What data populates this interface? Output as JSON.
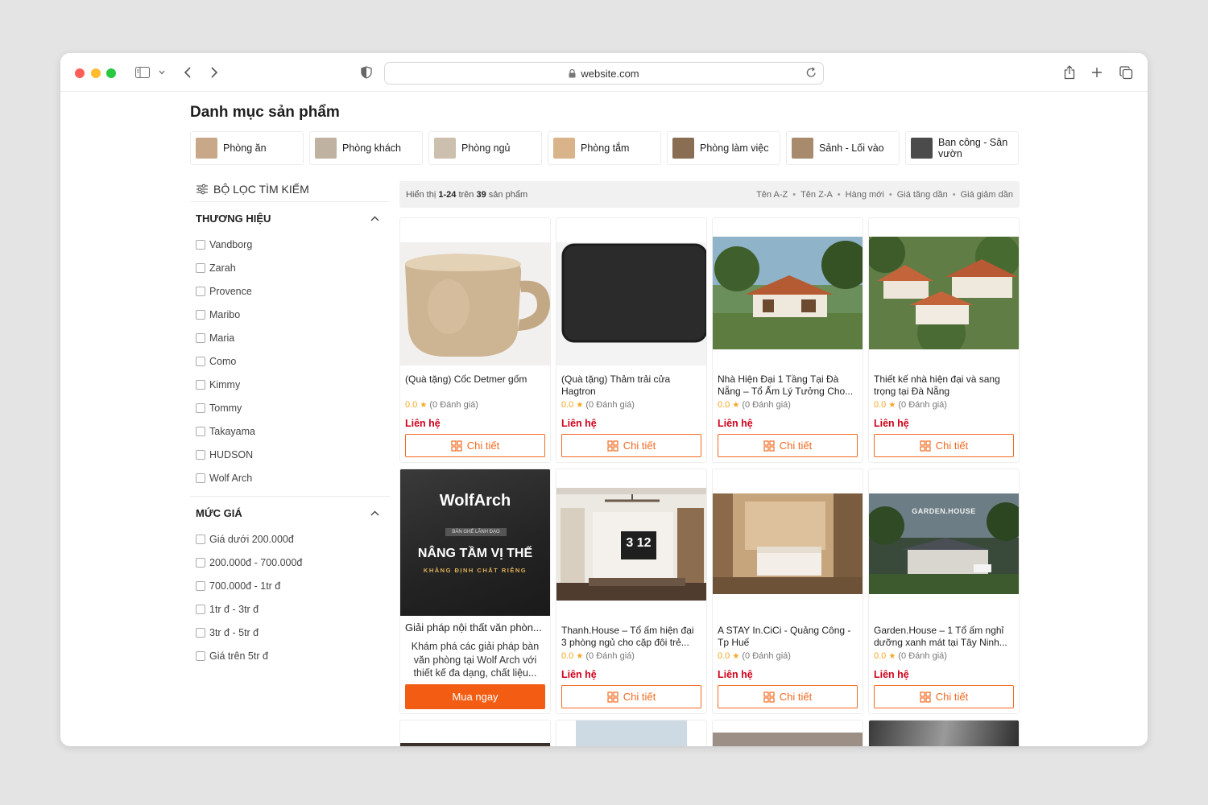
{
  "browser": {
    "url": "website.com"
  },
  "page": {
    "title": "Danh mục sản phẩm"
  },
  "categories": [
    {
      "label": "Phòng ăn",
      "thumb": "#c9a88a"
    },
    {
      "label": "Phòng khách",
      "thumb": "#bfb2a0"
    },
    {
      "label": "Phòng ngủ",
      "thumb": "#cdbfae"
    },
    {
      "label": "Phòng tắm",
      "thumb": "#d9b48a"
    },
    {
      "label": "Phòng làm việc",
      "thumb": "#8a6e54"
    },
    {
      "label": "Sảnh - Lối vào",
      "thumb": "#a88a6c"
    },
    {
      "label": "Ban công - Sân vườn",
      "thumb": "#4b4b4b"
    }
  ],
  "sidebar": {
    "filter_title": "BỘ LỌC TÌM KIẾM",
    "brand_title": "THƯƠNG HIỆU",
    "brands": [
      "Vandborg",
      "Zarah",
      "Provence",
      "Maribo",
      "Maria",
      "Como",
      "Kimmy",
      "Tommy",
      "Takayama",
      "HUDSON",
      "Wolf Arch"
    ],
    "price_title": "MỨC GIÁ",
    "prices": [
      "Giá dưới 200.000đ",
      "200.000đ - 700.000đ",
      "700.000đ - 1tr đ",
      "1tr đ - 3tr đ",
      "3tr đ - 5tr đ",
      "Giá trên 5tr đ"
    ]
  },
  "sortbar": {
    "prefix": "Hiển thị",
    "range": "1-24",
    "middle": "trên",
    "total": "39",
    "suffix": "sản phẩm",
    "options": [
      "Tên A-Z",
      "Tên Z-A",
      "Hàng mới",
      "Giá tăng dần",
      "Giá giảm dần"
    ]
  },
  "labels": {
    "contact": "Liên hệ",
    "detail": "Chi tiết",
    "buy": "Mua ngay",
    "rating_count": "(0 Đánh giá)"
  },
  "products": [
    {
      "name": "(Quà tặng) Cốc Detmer gốm",
      "rating": "0.0"
    },
    {
      "name": "(Quà tặng) Thảm trải cửa Hagtron",
      "rating": "0.0"
    },
    {
      "name": "Nhà Hiện Đại 1 Tầng Tại Đà Nẵng – Tổ Ấm Lý Tưởng Cho...",
      "rating": "0.0"
    },
    {
      "name": "Thiết kế nhà hiện đại và sang trọng tại Đà Nẵng",
      "rating": "0.0"
    },
    {
      "name": "Giải pháp nội thất văn phòn...",
      "desc": "Khám phá các giải pháp bàn văn phòng tại Wolf Arch với thiết kế đa dạng, chất liệu...",
      "banner_brand": "WolfArch",
      "banner_tag": "BÀN GHẾ LÃNH ĐẠO",
      "banner_headline": "NÂNG TẦM VỊ THẾ",
      "banner_sub": "KHẲNG ĐỊNH CHẤT RIÊNG"
    },
    {
      "name": "Thanh.House – Tổ ấm hiện đại 3 phòng ngủ cho cặp đôi trẻ...",
      "rating": "0.0",
      "clock": "3 12"
    },
    {
      "name": "A STAY In.CiCi - Quảng Công - Tp Huế",
      "rating": "0.0"
    },
    {
      "name": "Garden.House – 1 Tổ ấm nghỉ dưỡng xanh mát tại Tây Ninh...",
      "rating": "0.0",
      "banner_text": "GARDEN.HOUSE"
    }
  ],
  "colors": {
    "accent": "#f26a21",
    "price": "#d0021b",
    "star": "#f5a623"
  }
}
